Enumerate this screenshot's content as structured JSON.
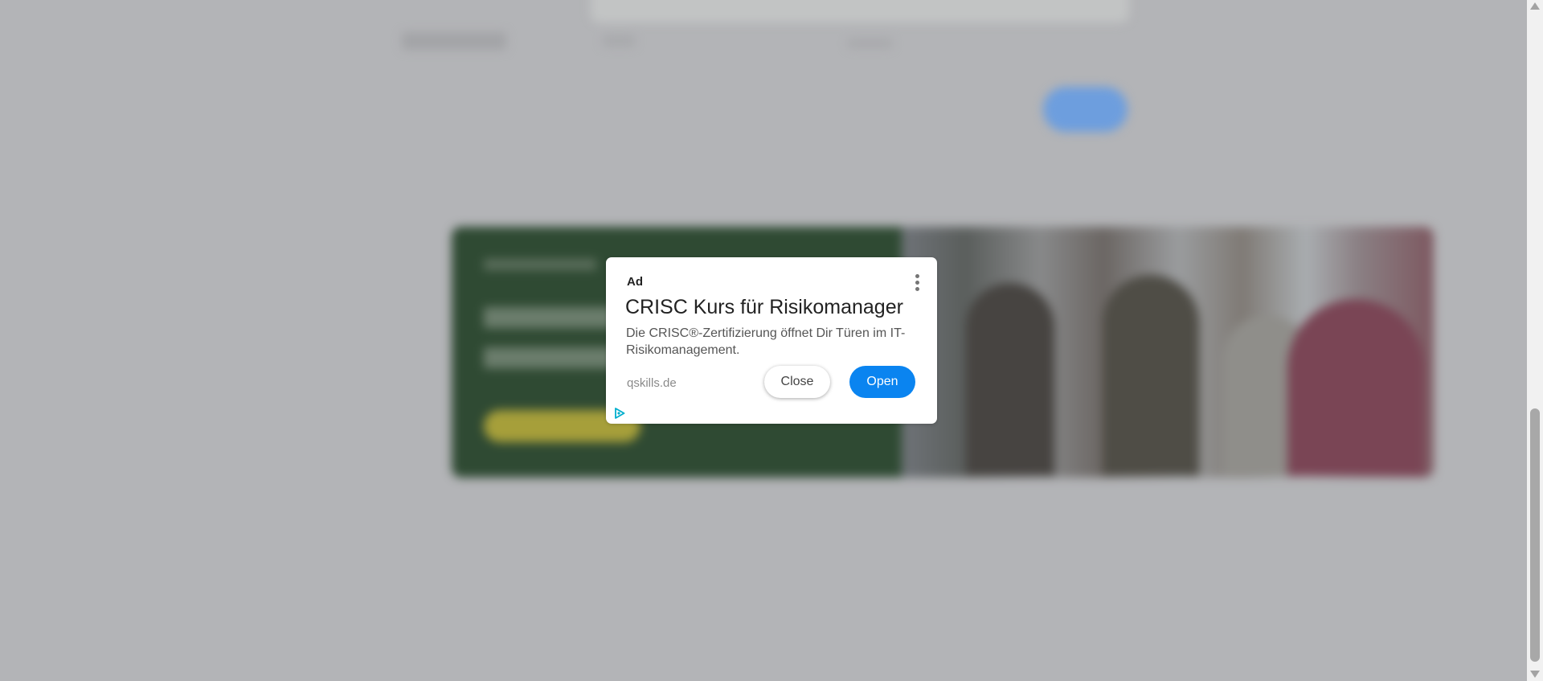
{
  "ad": {
    "label": "Ad",
    "title": "CRISC Kurs für Risikomanager",
    "description": "Die CRISC®-Zertifizierung öffnet Dir Türen im IT-Risikomanagement.",
    "domain": "qskills.de",
    "close_label": "Close",
    "open_label": "Open",
    "menu_icon": "more-vert-icon",
    "choices_icon": "adchoices-icon"
  },
  "colors": {
    "overlay": "#b3b4b7",
    "open_button": "#0a84f0",
    "adchoices": "#00aecd"
  }
}
